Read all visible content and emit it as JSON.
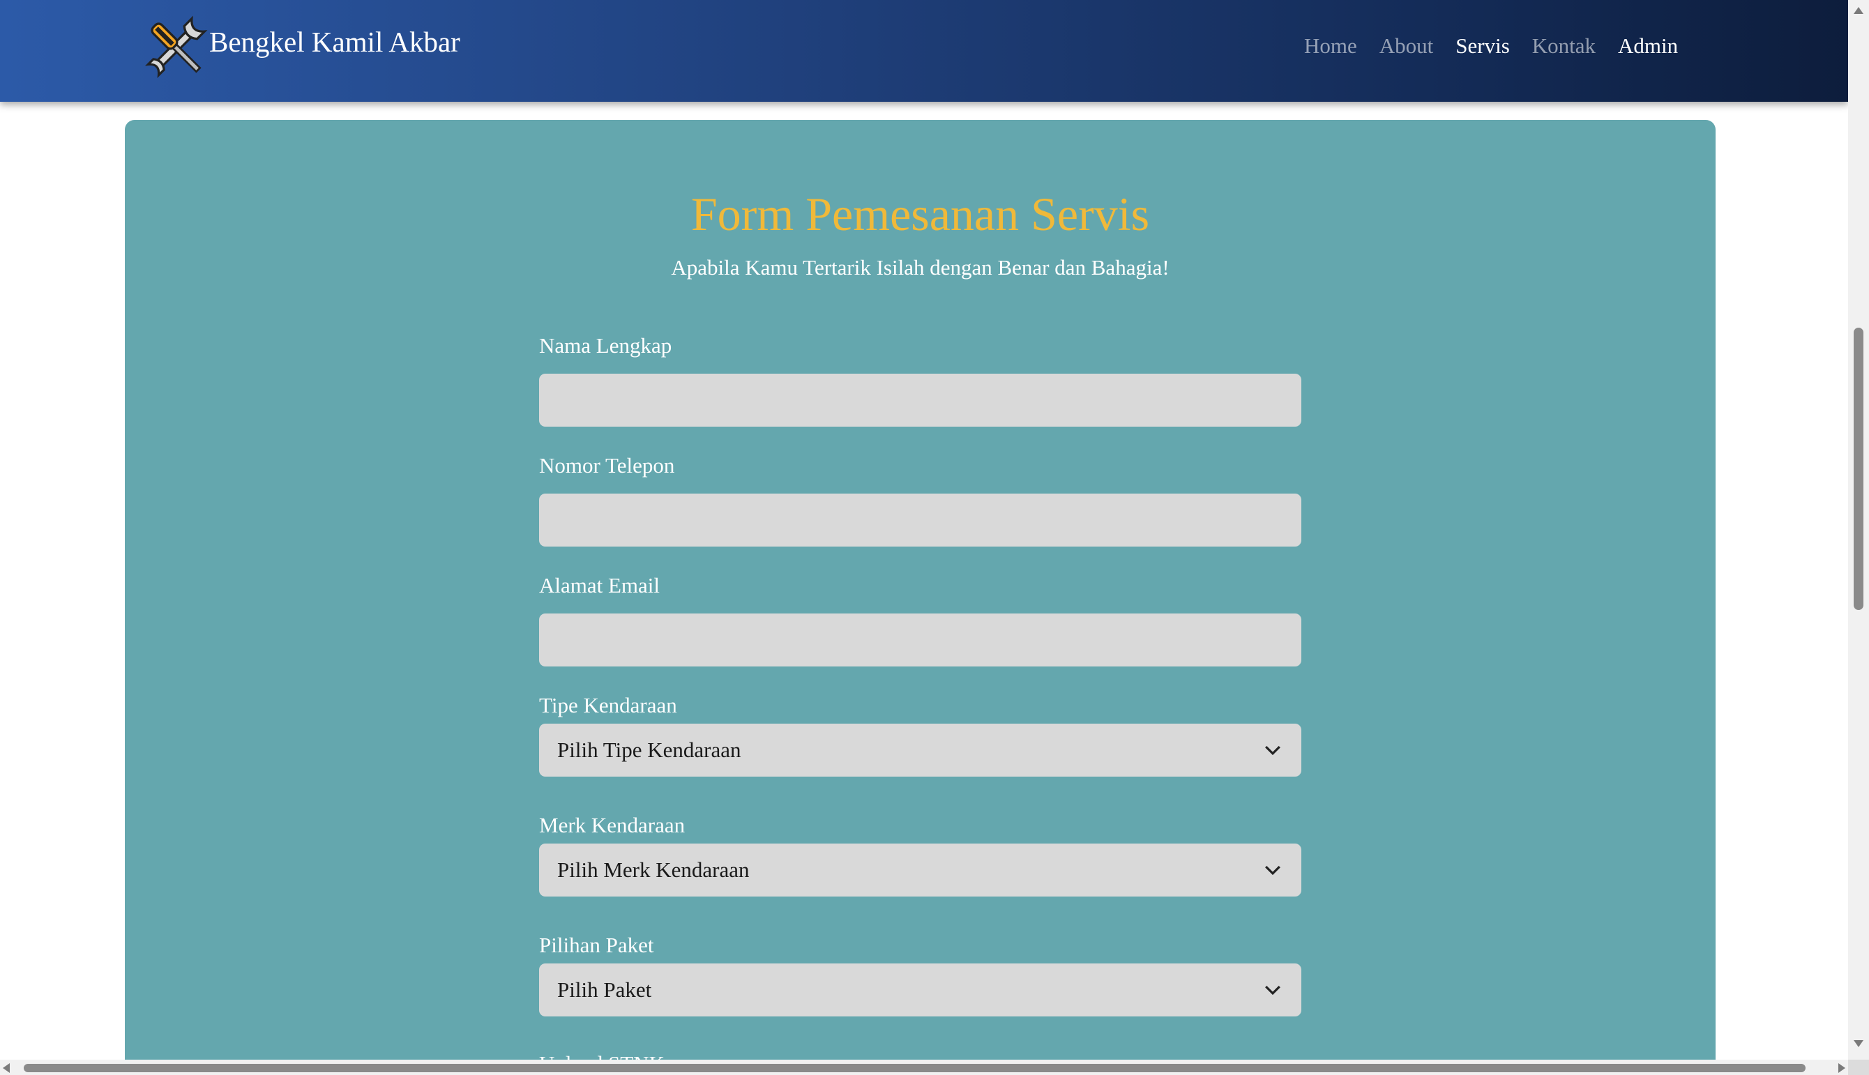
{
  "navbar": {
    "brand_name": "Bengkel Kamil Akbar",
    "brand_icon": "wrench-screwdriver-icon",
    "links": [
      {
        "label": "Home"
      },
      {
        "label": "About"
      },
      {
        "label": "Servis"
      },
      {
        "label": "Kontak"
      },
      {
        "label": "Admin"
      }
    ],
    "active_link": "Servis"
  },
  "form": {
    "title": "Form Pemesanan Servis",
    "subtitle": "Apabila Kamu Tertarik Isilah dengan Benar dan Bahagia!",
    "fields": {
      "nama": {
        "label": "Nama Lengkap",
        "value": ""
      },
      "telepon": {
        "label": "Nomor Telepon",
        "value": ""
      },
      "email": {
        "label": "Alamat Email",
        "value": ""
      },
      "tipe": {
        "label": "Tipe Kendaraan",
        "selected": "Pilih Tipe Kendaraan"
      },
      "merk": {
        "label": "Merk Kendaraan",
        "selected": "Pilih Merk Kendaraan"
      },
      "paket": {
        "label": "Pilihan Paket",
        "selected": "Pilih Paket"
      }
    },
    "cut_off_label": "Upload STNK"
  },
  "colors": {
    "nav_gradient_start": "#2c5aa8",
    "nav_gradient_end": "#0d1d3c",
    "card_bg": "#64a7ae",
    "title": "#f0b93a",
    "input_bg": "#d9d9d9"
  }
}
